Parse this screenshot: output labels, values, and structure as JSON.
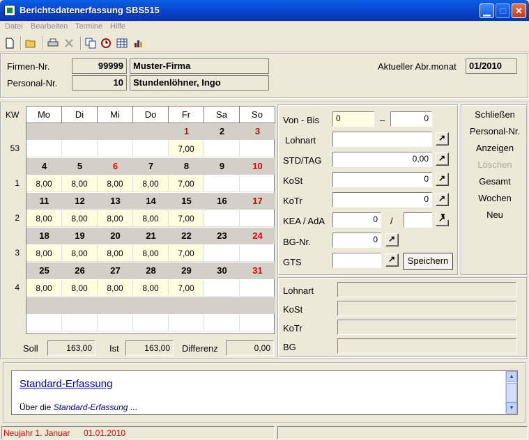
{
  "window": {
    "title": "Berichtsdatenerfassung SBS515"
  },
  "menu": [
    "Datei",
    "Bearbeiten",
    "Termine",
    "Hilfe"
  ],
  "toolbar_icons": [
    "new-icon",
    "open-icon",
    "print-icon",
    "delete-icon",
    "copy-icon",
    "clock-icon",
    "table-icon",
    "chart-icon"
  ],
  "header": {
    "firm_label": "Firmen-Nr.",
    "firm_nr": "99999",
    "firm_name": "Muster-Firma",
    "pers_label": "Personal-Nr.",
    "pers_nr": "10",
    "pers_name": "Stundenlöhner, Ingo",
    "month_label": "Aktueller Abr.monat",
    "month_value": "01/2010"
  },
  "calendar": {
    "kw_label": "KW",
    "days": [
      "Mo",
      "Di",
      "Mi",
      "Do",
      "Fr",
      "Sa",
      "So"
    ],
    "weeks": [
      {
        "kw": "53",
        "dates": [
          "",
          "",
          "",
          "",
          "1",
          "2",
          "3"
        ],
        "values": [
          "",
          "",
          "",
          "",
          "7,00",
          "",
          ""
        ]
      },
      {
        "kw": "1",
        "dates": [
          "4",
          "5",
          "6",
          "7",
          "8",
          "9",
          "10"
        ],
        "values": [
          "8,00",
          "8,00",
          "8,00",
          "8,00",
          "7,00",
          "",
          ""
        ]
      },
      {
        "kw": "2",
        "dates": [
          "11",
          "12",
          "13",
          "14",
          "15",
          "16",
          "17"
        ],
        "values": [
          "8,00",
          "8,00",
          "8,00",
          "8,00",
          "7,00",
          "",
          ""
        ]
      },
      {
        "kw": "3",
        "dates": [
          "18",
          "19",
          "20",
          "21",
          "22",
          "23",
          "24"
        ],
        "values": [
          "8,00",
          "8,00",
          "8,00",
          "8,00",
          "7,00",
          "",
          ""
        ]
      },
      {
        "kw": "4",
        "dates": [
          "25",
          "26",
          "27",
          "28",
          "29",
          "30",
          "31"
        ],
        "values": [
          "8,00",
          "8,00",
          "8,00",
          "8,00",
          "7,00",
          "",
          ""
        ]
      },
      {
        "kw": "",
        "dates": [
          "",
          "",
          "",
          "",
          "",
          "",
          ""
        ],
        "values": [
          "",
          "",
          "",
          "",
          "",
          "",
          ""
        ]
      }
    ]
  },
  "totals": {
    "soll_label": "Soll",
    "soll": "163,00",
    "ist_label": "Ist",
    "ist": "163,00",
    "diff_label": "Differenz",
    "diff": "0,00"
  },
  "form": {
    "vonbis_label": "Von - Bis",
    "von": "0",
    "dash": "–",
    "bis": "0",
    "lohnart_label": "Lohnart",
    "std_label": "STD/TAG",
    "std": "0,00",
    "kost_label": "KoSt",
    "kost": "0",
    "kotr_label": "KoTr",
    "kotr": "0",
    "kea_label": "KEA / AdA",
    "kea": "0",
    "slash": "/",
    "bg_label": "BG-Nr.",
    "bg": "0",
    "gts_label": "GTS",
    "save_button": "Speichern"
  },
  "actions": {
    "close": "Schließen",
    "personal": "Personal-Nr.",
    "show": "Anzeigen",
    "delete": "Löschen",
    "total": "Gesamt",
    "weeks": "Wochen",
    "new": "Neu"
  },
  "info": {
    "lohnart": "Lohnart",
    "kost": "KoSt",
    "kotr": "KoTr",
    "bg": "BG"
  },
  "help": {
    "title": "Standard-Erfassung",
    "text_prefix": "Über die ",
    "text_link": "Standard-Erfassung",
    "text_suffix": " ..."
  },
  "status": {
    "holiday": "Neujahr 1. Januar",
    "date": "01.01.2010"
  },
  "colors": {
    "accent": "#0a246a",
    "weekend_red": "#e00000",
    "filled_cell": "#fffde0"
  }
}
